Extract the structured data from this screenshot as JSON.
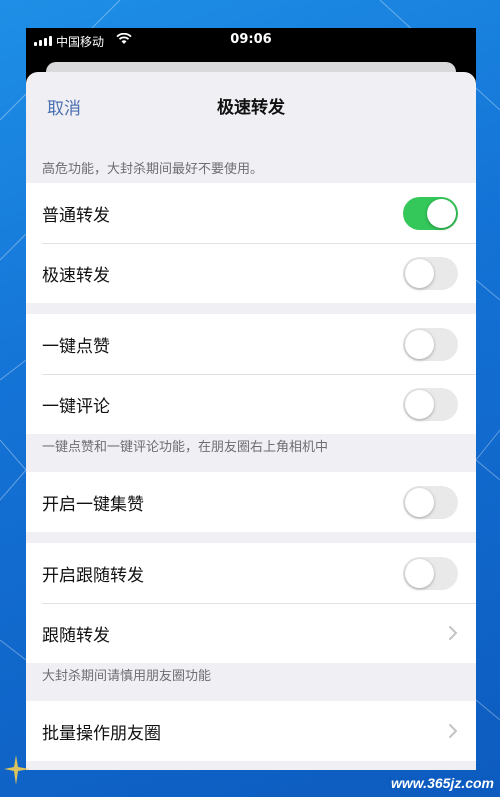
{
  "status_bar": {
    "carrier": "中国移动",
    "time": "09:06"
  },
  "nav": {
    "cancel_label": "取消",
    "title": "极速转发"
  },
  "section1": {
    "header": "高危功能，大封杀期间最好不要使用。",
    "rows": [
      {
        "label": "普通转发",
        "toggle_on": true
      },
      {
        "label": "极速转发",
        "toggle_on": false
      }
    ]
  },
  "section2": {
    "rows": [
      {
        "label": "一键点赞",
        "toggle_on": false
      },
      {
        "label": "一键评论",
        "toggle_on": false
      }
    ],
    "footer": "一键点赞和一键评论功能，在朋友圈右上角相机中"
  },
  "section3": {
    "rows": [
      {
        "label": "开启一键集赞",
        "toggle_on": false
      }
    ]
  },
  "section4": {
    "rows": [
      {
        "label": "开启跟随转发",
        "toggle_on": false
      },
      {
        "label": "跟随转发",
        "icon": "chevron-right-icon"
      }
    ],
    "footer": "大封杀期间请慎用朋友圈功能"
  },
  "section5": {
    "rows": [
      {
        "label": "批量操作朋友圈",
        "icon": "chevron-right-icon"
      }
    ]
  },
  "watermark": "www.365jz.com",
  "colors": {
    "toggle_on": "#34c759",
    "toggle_off": "#e9e9ea",
    "link": "#4a6fb0",
    "background": "#1473d6"
  }
}
